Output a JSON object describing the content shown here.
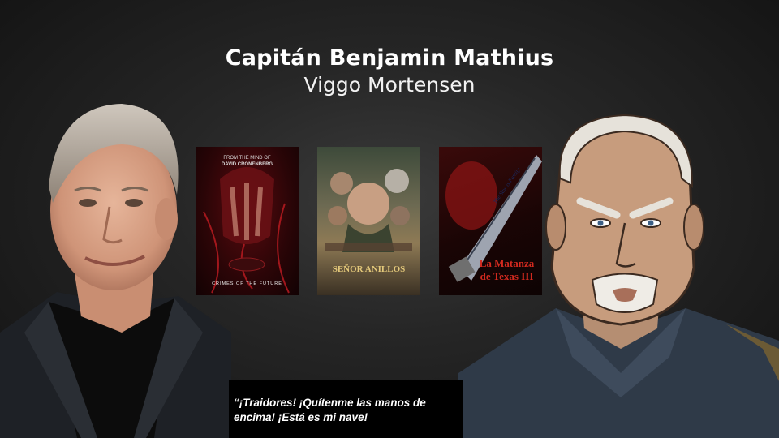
{
  "slide": {
    "character_name": "Capitán Benjamin Mathius",
    "actor_name": "Viggo Mortensen",
    "quote": "“¡Traidores! ¡Quítenme las manos de encima! ¡Está es mi nave!"
  },
  "posters": [
    {
      "name": "crimes-of-the-future",
      "top_text": "FROM THE MIND OF",
      "director": "DAVID CRONENBERG",
      "bottom_text": "CRIMES OF THE FUTURE",
      "accent": "#b3151b"
    },
    {
      "name": "senor-de-los-anillos",
      "title": "SEÑOR ANILLOS",
      "accent": "#c9a84a"
    },
    {
      "name": "la-matanza-de-texas",
      "title_line1": "La Matanza",
      "title_line2": "de Texas III",
      "tagline": "The Saw is Family",
      "accent": "#c21a1a"
    }
  ],
  "colors": {
    "background": "#1a1a1a",
    "quote_box": "#000000",
    "uniform": "#2f3a48"
  }
}
